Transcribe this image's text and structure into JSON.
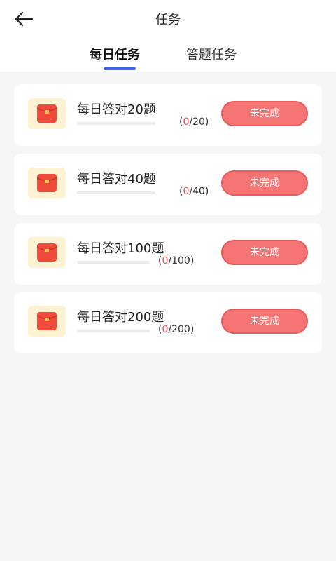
{
  "header": {
    "title": "任务",
    "back_icon": "arrow-left-icon"
  },
  "tabs": [
    {
      "label": "每日任务",
      "active": true
    },
    {
      "label": "答题任务",
      "active": false
    }
  ],
  "tasks": [
    {
      "title": "每日答对20题",
      "done": "0",
      "total": "/20",
      "button": "未完成",
      "icon": "red-envelope-icon",
      "progress": 0
    },
    {
      "title": "每日答对40题",
      "done": "0",
      "total": "/40",
      "button": "未完成",
      "icon": "red-envelope-icon",
      "progress": 0
    },
    {
      "title": "每日答对100题",
      "done": "0",
      "total": "/100",
      "button": "未完成",
      "icon": "red-envelope-icon",
      "progress": 0
    },
    {
      "title": "每日答对200题",
      "done": "0",
      "total": "/200",
      "button": "未完成",
      "icon": "red-envelope-icon",
      "progress": 0
    }
  ],
  "colors": {
    "accent": "#3f61e8",
    "button": "#f57474",
    "progress_done": "#e14b4b",
    "icon_bg": "#fdf3d3"
  }
}
